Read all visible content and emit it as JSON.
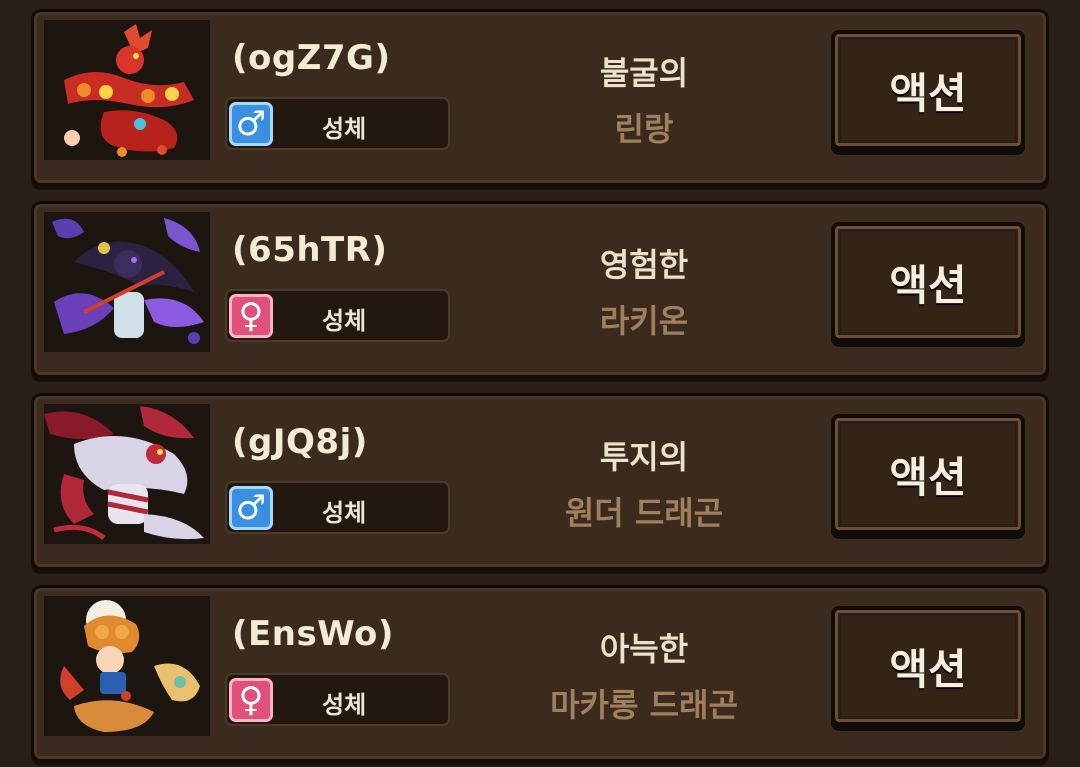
{
  "entries": [
    {
      "name": "(ogZ7G)",
      "gender": "male",
      "gender_symbol": "♂",
      "stage": "성체",
      "title_line1": "불굴의",
      "title_line2": "린랑",
      "action_label": "액션",
      "accent": "#d9352a"
    },
    {
      "name": "(65hTR)",
      "gender": "female",
      "gender_symbol": "♀",
      "stage": "성체",
      "title_line1": "영험한",
      "title_line2": "라키온",
      "action_label": "액션",
      "accent": "#6a3fb8"
    },
    {
      "name": "(gJQ8j)",
      "gender": "male",
      "gender_symbol": "♂",
      "stage": "성체",
      "title_line1": "투지의",
      "title_line2": "원더 드래곤",
      "action_label": "액션",
      "accent": "#b0283a"
    },
    {
      "name": "(EnsWo)",
      "gender": "female",
      "gender_symbol": "♀",
      "stage": "성체",
      "title_line1": "아늑한",
      "title_line2": "마카롱 드래곤",
      "action_label": "액션",
      "accent": "#e08a3a"
    }
  ],
  "colors": {
    "male": "#3b8fe0",
    "female": "#e0507a",
    "card_bg": "#3a2b1e",
    "title_secondary": "#a0805c"
  }
}
